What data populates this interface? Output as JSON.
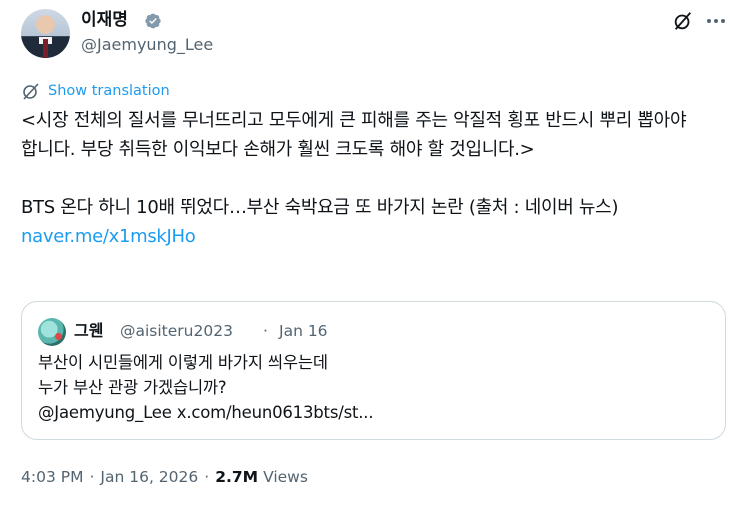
{
  "author": {
    "display_name": "이재명",
    "handle": "@Jaemyung_Lee",
    "verified_color": "#829aab"
  },
  "header": {
    "grok_icon": "grok-icon",
    "more_icon": "more-horizontal-icon"
  },
  "translation": {
    "label": "Show translation",
    "icon": "translate-icon"
  },
  "tweet": {
    "text": "<시장 전체의 질서를 무너뜨리고 모두에게 큰 피해를 주는 악질적 횡포 반드시 뿌리 뽑아야 합니다. 부당 취득한 이익보다 손해가 훨씬 크도록 해야 할 것입니다.>\n\nBTS 온다 하니 10배 뛰었다…부산 숙박요금 또 바가지 논란 (출처 : 네이버 뉴스) ",
    "link": "naver.me/x1mskJHo"
  },
  "quote": {
    "display_name": "그웬",
    "handle": "@aisiteru2023",
    "separator": "·",
    "date": "Jan 16",
    "line1": "부산이 시민들에게 이렇게 바가지 씌우는데",
    "line2": "누가 부산 관광 가겠습니까?",
    "line3": "@Jaemyung_Lee x.com/heun0613bts/st..."
  },
  "meta": {
    "time": "4:03 PM",
    "separator": "·",
    "date": "Jan 16, 2026",
    "views_count": "2.7M",
    "views_label": "Views"
  },
  "colors": {
    "link": "#1d9bf0",
    "secondary_text": "#536471",
    "border": "#cfd9de"
  }
}
